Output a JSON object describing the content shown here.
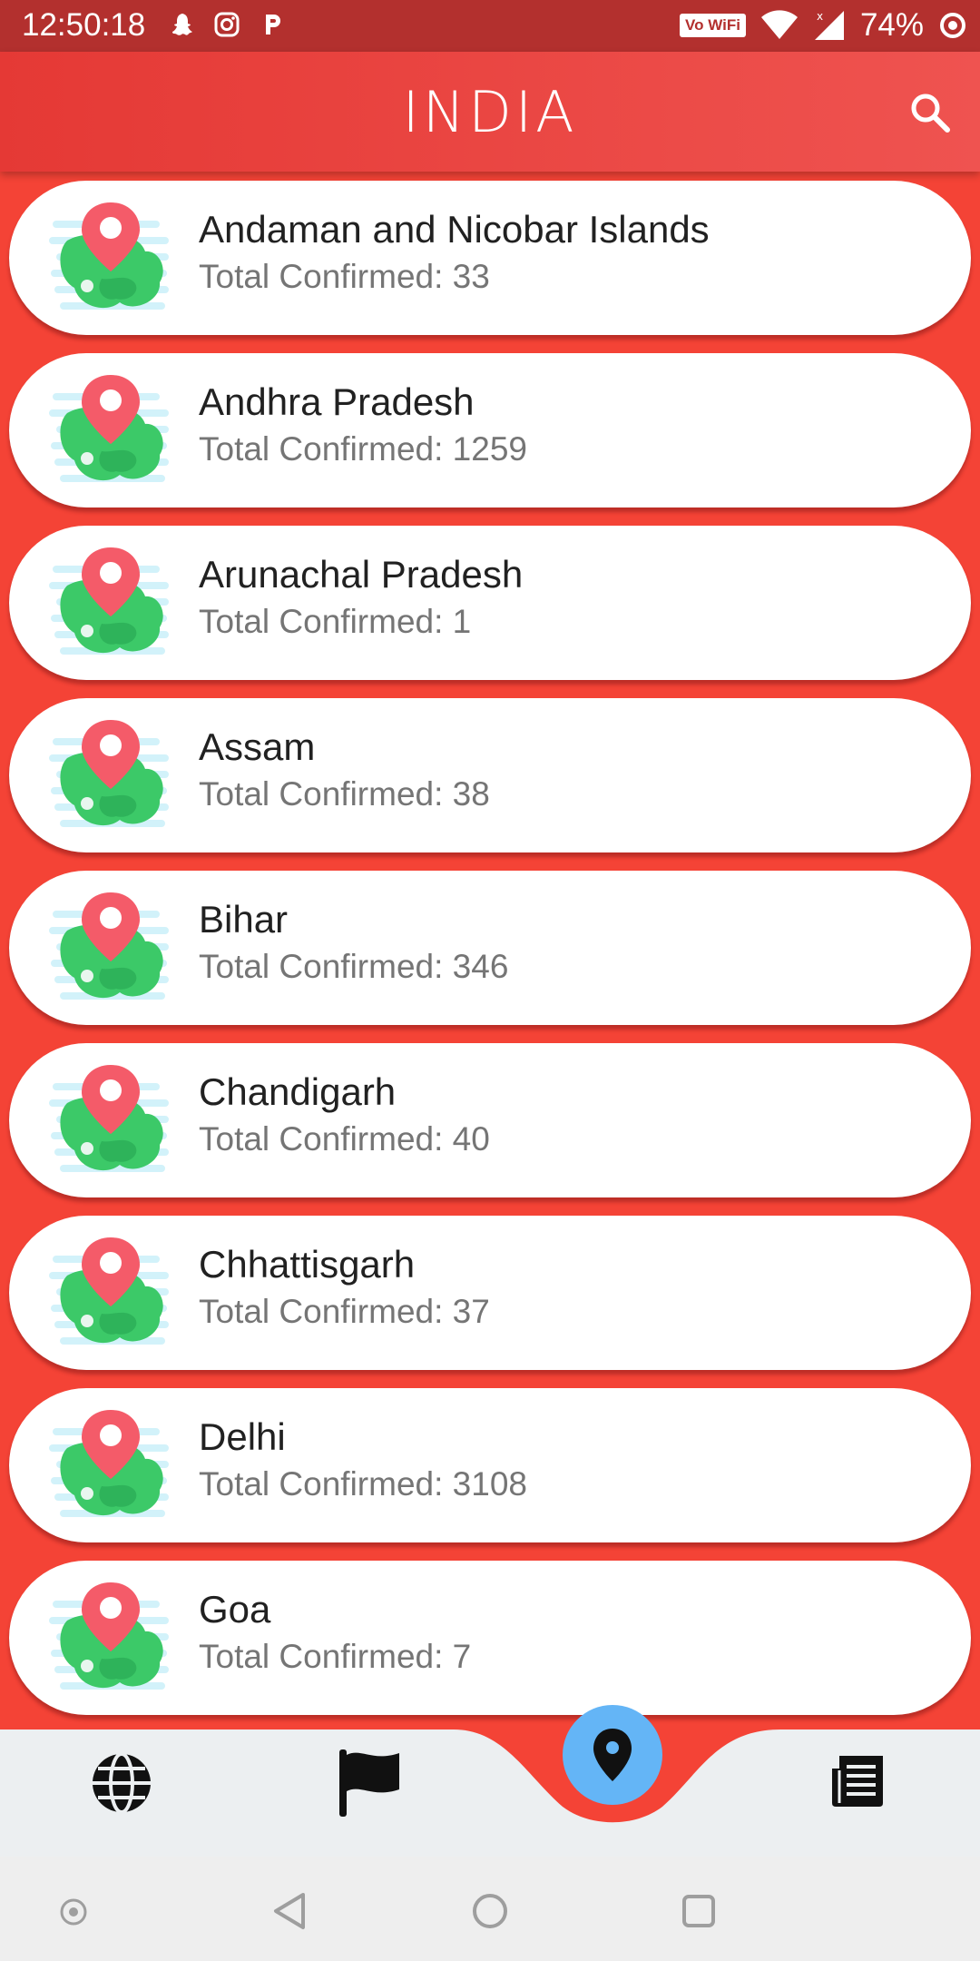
{
  "status_bar": {
    "time": "12:50:18",
    "wifi_badge": "Vo WiFi",
    "battery": "74%"
  },
  "app_bar": {
    "title": "INDIA",
    "search_icon": "search-icon"
  },
  "states": [
    {
      "name": "Andaman and Nicobar Islands",
      "confirmed": "Total Confirmed: 33"
    },
    {
      "name": "Andhra Pradesh",
      "confirmed": "Total Confirmed: 1259"
    },
    {
      "name": "Arunachal Pradesh",
      "confirmed": "Total Confirmed: 1"
    },
    {
      "name": "Assam",
      "confirmed": "Total Confirmed: 38"
    },
    {
      "name": "Bihar",
      "confirmed": "Total Confirmed: 346"
    },
    {
      "name": "Chandigarh",
      "confirmed": "Total Confirmed: 40"
    },
    {
      "name": "Chhattisgarh",
      "confirmed": "Total Confirmed: 37"
    },
    {
      "name": "Delhi",
      "confirmed": "Total Confirmed: 3108"
    },
    {
      "name": "Goa",
      "confirmed": "Total Confirmed: 7"
    }
  ],
  "bottom_nav": {
    "items": [
      "globe-icon",
      "flag-icon",
      "location-pin-icon",
      "newspaper-icon"
    ],
    "active": "location-pin-icon"
  },
  "colors": {
    "background": "#f44336",
    "app_bar": "#e53935",
    "status_bar": "#b3302e",
    "fab": "#64b5f6",
    "nav_bg": "#eceff1"
  }
}
